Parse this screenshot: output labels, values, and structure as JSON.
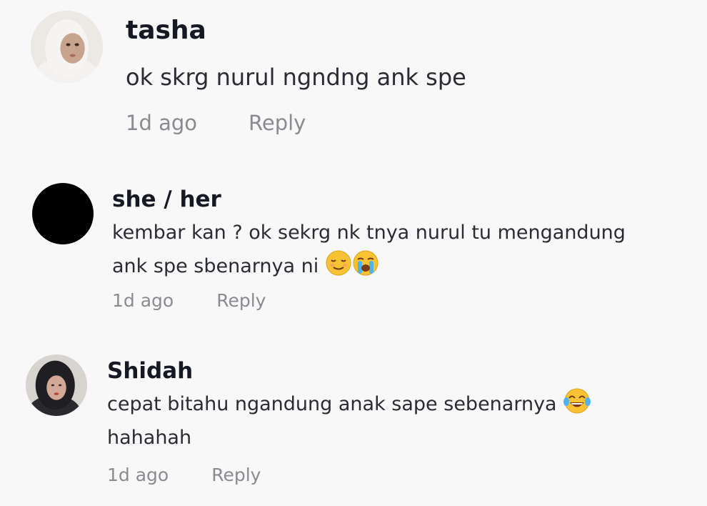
{
  "comments": [
    {
      "username": "tasha",
      "text": "ok skrg nurul ngndng ank spe",
      "time": "1d ago",
      "reply_label": "Reply",
      "avatar": "profile-photo-avatar"
    },
    {
      "username": "she / her",
      "text_line1": "kembar kan ? ok sekrg nk tnya nurul tu mengandung",
      "text_line2": "ank spe sbenarnya ni",
      "emojis": [
        "relieved-face-emoji",
        "crying-face-emoji"
      ],
      "time": "1d ago",
      "reply_label": "Reply",
      "avatar": "black-circle-avatar"
    },
    {
      "username": "Shidah",
      "text_line1": "cepat bitahu ngandung anak sape sebenarnya",
      "text_line2": "hahahah",
      "emojis": [
        "tears-of-joy-emoji"
      ],
      "time": "1d ago",
      "reply_label": "Reply",
      "avatar": "profile-photo-avatar"
    }
  ],
  "colors": {
    "background": "#f8f8f8",
    "username": "#161823",
    "text": "#2b2b33",
    "meta": "#8a8b91",
    "emoji_yellow": "#f7c233"
  }
}
